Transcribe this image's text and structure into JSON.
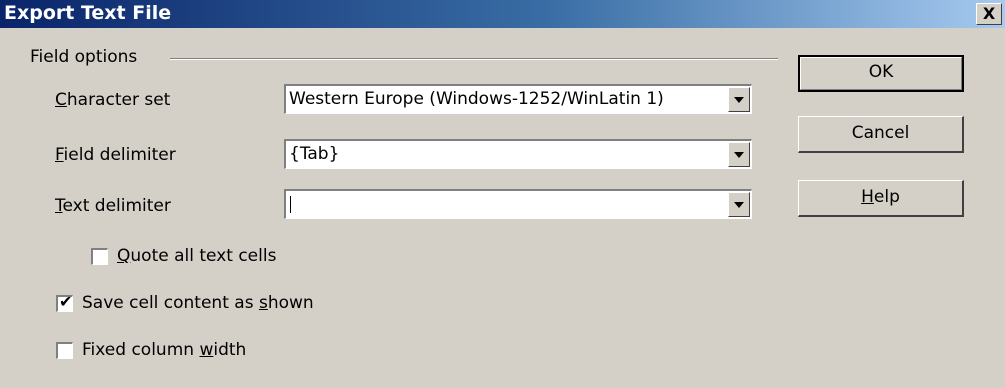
{
  "window": {
    "title": "Export Text File",
    "close_label": "X"
  },
  "field_options": {
    "group_label": "Field options",
    "character_set": {
      "label_mnemonic": "C",
      "label_rest": "haracter set",
      "value": "Western Europe (Windows-1252/WinLatin 1)"
    },
    "field_delimiter": {
      "label_mnemonic": "F",
      "label_rest": "ield delimiter",
      "value": "{Tab}"
    },
    "text_delimiter": {
      "label_mnemonic": "T",
      "label_rest": "ext delimiter",
      "value": ""
    }
  },
  "checkboxes": {
    "quote_all": {
      "label_mnemonic": "Q",
      "label_rest": "uote all text cells",
      "checked": false
    },
    "save_as_shown": {
      "label_before": "Save cell content as ",
      "label_mnemonic": "s",
      "label_after": "hown",
      "checked": true,
      "check_glyph": "✔"
    },
    "fixed_width": {
      "label_before": "Fixed column ",
      "label_mnemonic": "w",
      "label_after": "idth",
      "checked": false
    }
  },
  "buttons": {
    "ok": "OK",
    "cancel": "Cancel",
    "help_mnemonic": "H",
    "help_rest": "elp"
  },
  "icons": {
    "dropdown": "chevron-down-icon",
    "close": "close-icon",
    "checkmark": "checkmark-icon"
  }
}
